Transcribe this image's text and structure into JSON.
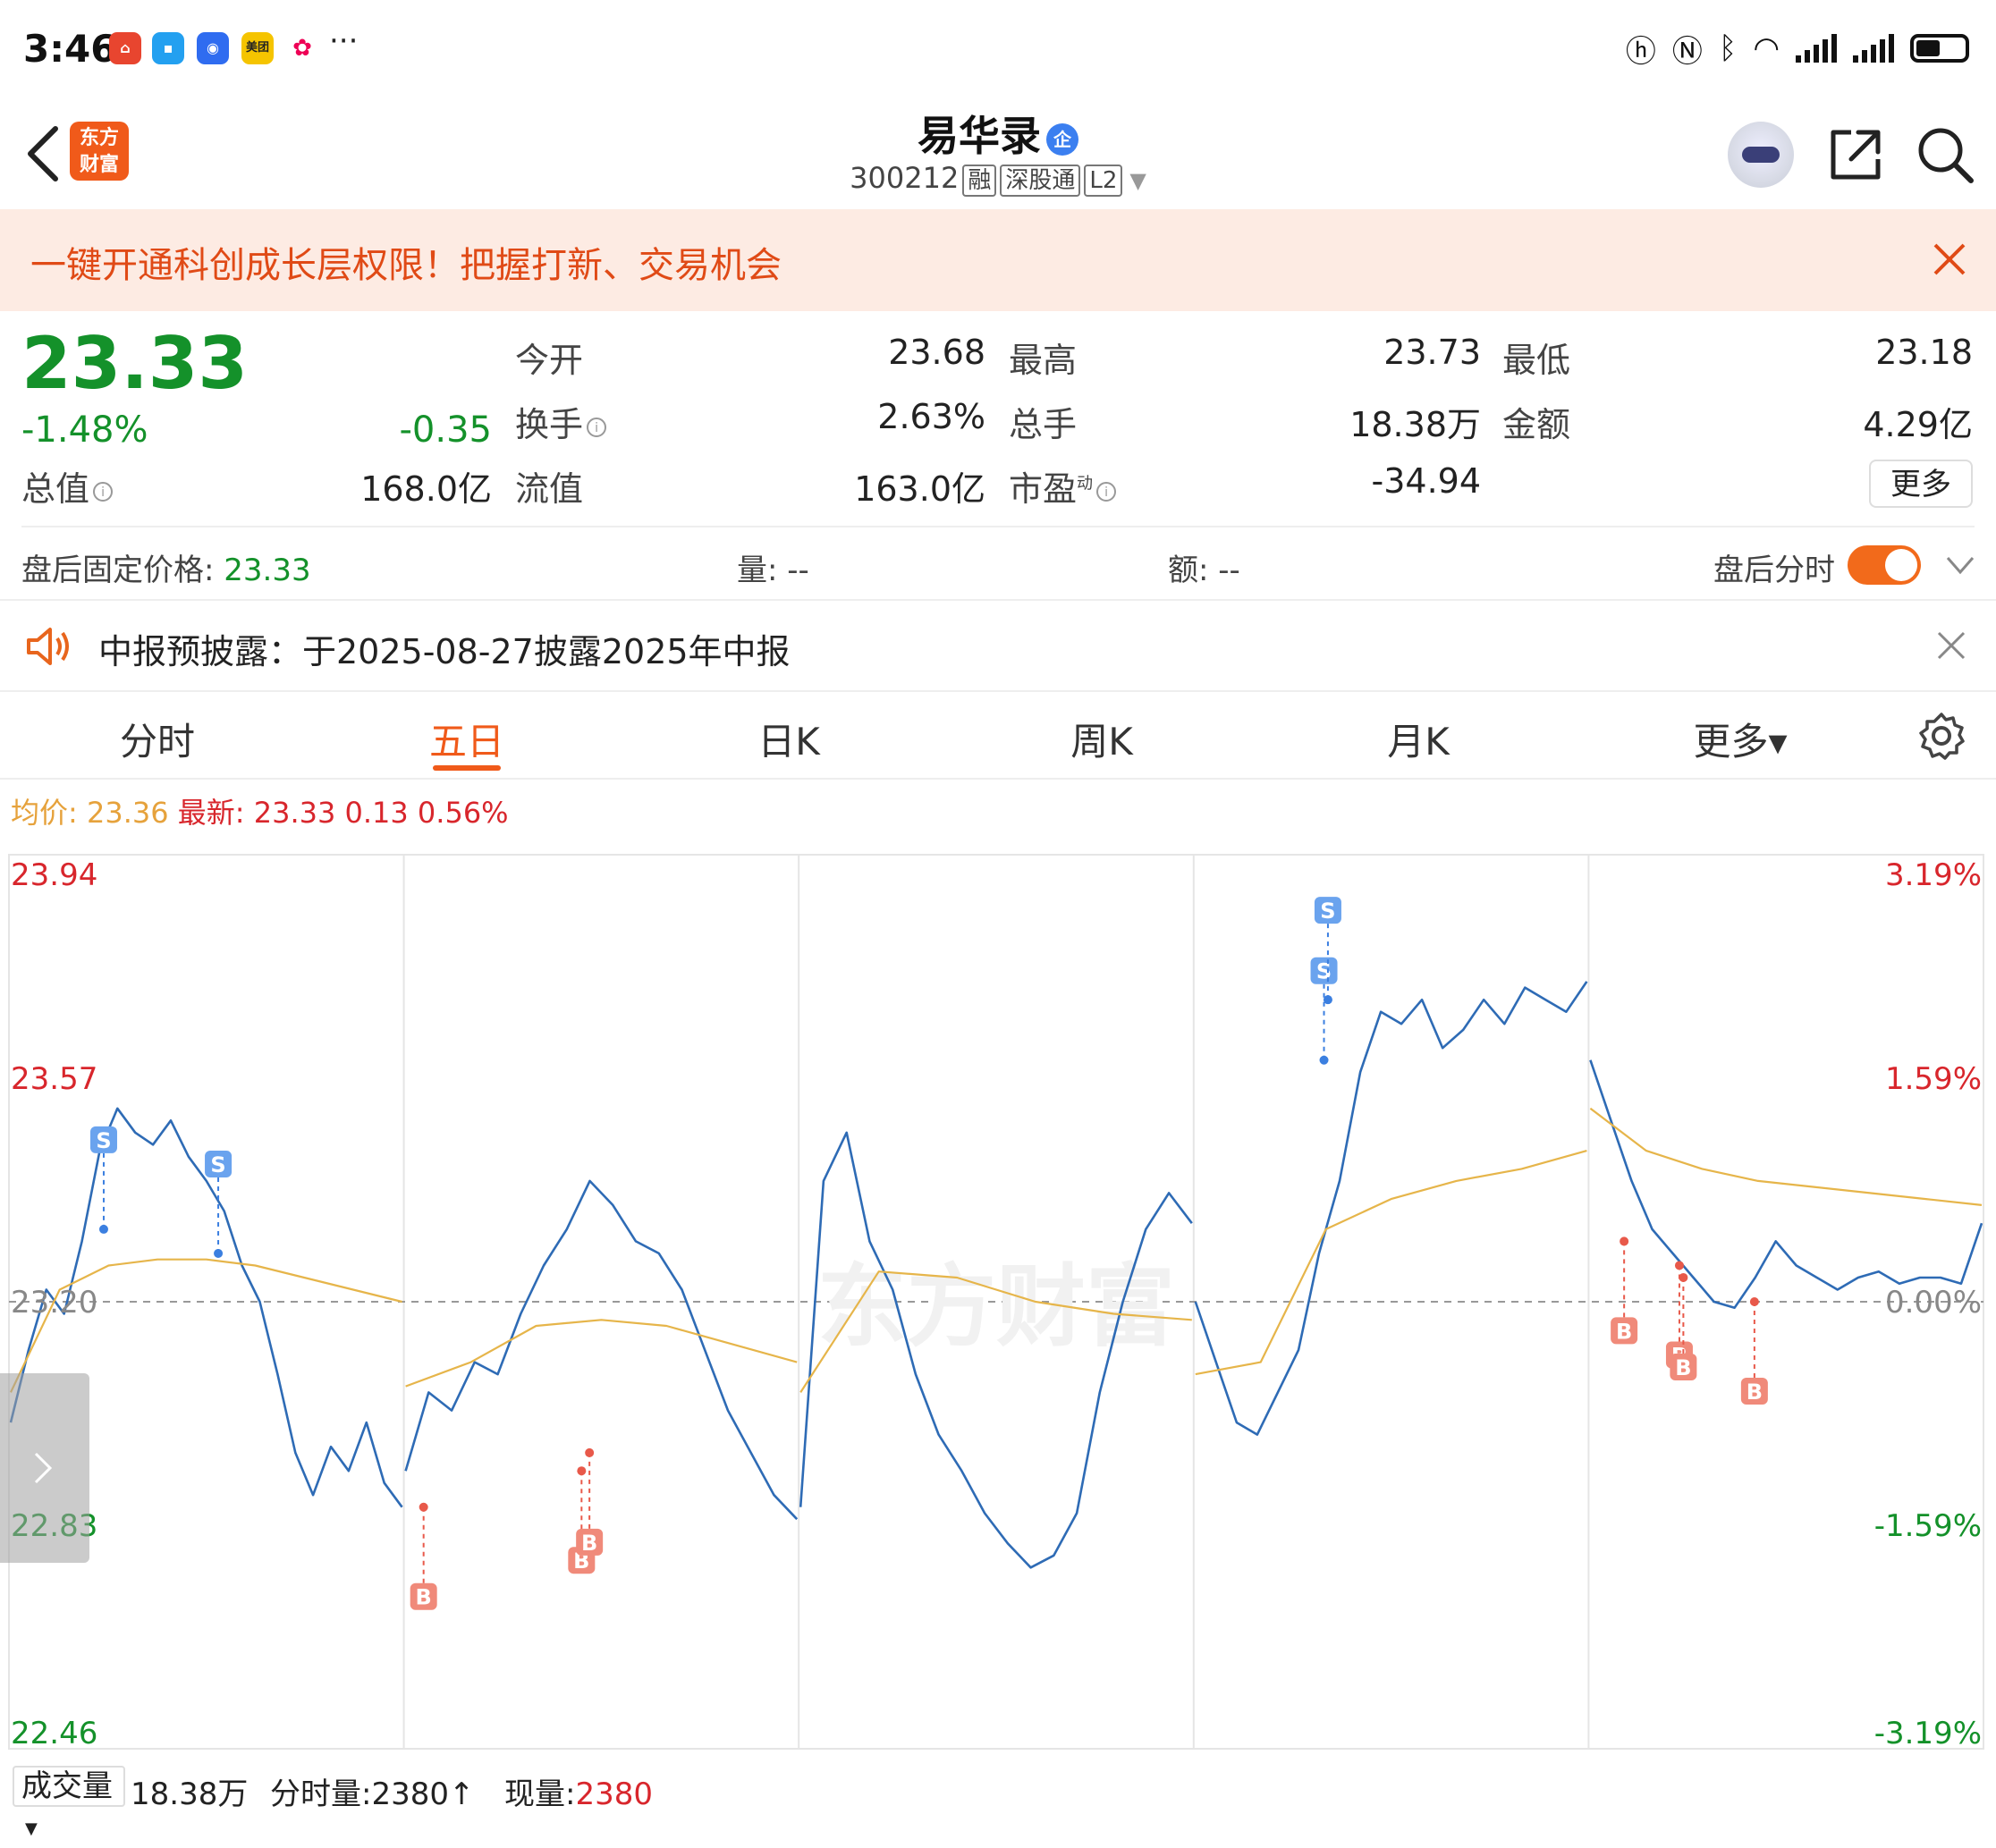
{
  "status_bar": {
    "time": "3:46",
    "app_icons": [
      {
        "name": "red-app-icon",
        "label": "",
        "color": "#e8452f"
      },
      {
        "name": "chat-app-icon",
        "label": "",
        "color": "#23a0f0"
      },
      {
        "name": "blue-app-icon",
        "label": "",
        "color": "#2f6cf0"
      },
      {
        "name": "meituan-app-icon",
        "label": "美团",
        "color": "#f5c400"
      },
      {
        "name": "flower-app-icon",
        "label": "",
        "color": "#ffffff"
      }
    ],
    "more": "···"
  },
  "header": {
    "stock_name": "易华录",
    "badge": "企",
    "stock_code": "300212",
    "tags": [
      "融",
      "深股通",
      "L2"
    ],
    "logo_text_top": "东方",
    "logo_text_bottom": "财富"
  },
  "banner": {
    "text": "一键开通科创成长层权限！把握打新、交易机会"
  },
  "quote": {
    "price": "23.33",
    "change_pct": "-1.48%",
    "change_val": "-0.35",
    "rows": [
      [
        {
          "label": "今开",
          "value": "23.68",
          "color": "#222222"
        },
        {
          "label": "最高",
          "value": "23.73",
          "color": "#d8262c"
        },
        {
          "label": "最低",
          "value": "23.18",
          "color": "#14912a"
        }
      ],
      [
        {
          "label": "换手",
          "value": "2.63%",
          "color": "#222222",
          "info": true
        },
        {
          "label": "总手",
          "value": "18.38万",
          "color": "#222222"
        },
        {
          "label": "金额",
          "value": "4.29亿",
          "color": "#222222"
        }
      ]
    ],
    "total_value_label": "总值",
    "total_value": "168.0亿",
    "float_value_label": "流值",
    "float_value": "163.0亿",
    "pe_label": "市盈",
    "pe_sup": "动",
    "pe_value": "-34.94",
    "more_button": "更多"
  },
  "afterhours": {
    "fixed_price_label": "盘后固定价格:",
    "fixed_price": "23.33",
    "volume_label": "量: --",
    "amount_label": "额: --",
    "toggle_label": "盘后分时",
    "toggle_on": true
  },
  "notice": {
    "text": "中报预披露：于2025-08-27披露2025年中报"
  },
  "tabs": [
    {
      "label": "分时",
      "active": false
    },
    {
      "label": "五日",
      "active": true
    },
    {
      "label": "日K",
      "active": false
    },
    {
      "label": "周K",
      "active": false
    },
    {
      "label": "月K",
      "active": false
    },
    {
      "label": "更多▾",
      "active": false
    }
  ],
  "legend": {
    "avg_label": "均价:",
    "avg_value": "23.36",
    "latest_label": "最新:",
    "latest_value": "23.33",
    "latest_change": "0.13",
    "latest_pct": "0.56%"
  },
  "chart_data": {
    "type": "line",
    "title": "",
    "days": 5,
    "ylim": [
      22.46,
      23.94
    ],
    "reference_price": 23.2,
    "y_ticks_left": [
      {
        "value": 23.94,
        "label": "23.94",
        "color": "#d8262c"
      },
      {
        "value": 23.57,
        "label": "23.57",
        "color": "#d8262c"
      },
      {
        "value": 23.2,
        "label": "23.20",
        "color": "#888888"
      },
      {
        "value": 22.83,
        "label": "22.83",
        "color": "#14912a"
      },
      {
        "value": 22.46,
        "label": "22.46",
        "color": "#14912a"
      }
    ],
    "y_ticks_right": [
      {
        "value": 23.94,
        "label": "3.19%",
        "color": "#d8262c"
      },
      {
        "value": 23.57,
        "label": "1.59%",
        "color": "#d8262c"
      },
      {
        "value": 23.2,
        "label": "0.00%",
        "color": "#888888"
      },
      {
        "value": 22.83,
        "label": "-1.59%",
        "color": "#14912a"
      },
      {
        "value": 22.46,
        "label": "-3.19%",
        "color": "#14912a"
      }
    ],
    "series": [
      {
        "color": "#2e6bb5",
        "days": [
          [
            23.0,
            23.12,
            23.22,
            23.18,
            23.3,
            23.45,
            23.52,
            23.48,
            23.46,
            23.5,
            23.44,
            23.4,
            23.35,
            23.26,
            23.2,
            23.08,
            22.95,
            22.88,
            22.96,
            22.92,
            23.0,
            22.9,
            22.86
          ],
          [
            22.92,
            23.05,
            23.02,
            23.1,
            23.08,
            23.18,
            23.26,
            23.32,
            23.4,
            23.36,
            23.3,
            23.28,
            23.22,
            23.12,
            23.02,
            22.95,
            22.88,
            22.84
          ],
          [
            22.86,
            23.4,
            23.48,
            23.3,
            23.22,
            23.08,
            22.98,
            22.92,
            22.85,
            22.8,
            22.76,
            22.78,
            22.85,
            23.05,
            23.2,
            23.32,
            23.38,
            23.33
          ],
          [
            23.2,
            23.1,
            23.0,
            22.98,
            23.05,
            23.12,
            23.28,
            23.4,
            23.58,
            23.68,
            23.66,
            23.7,
            23.62,
            23.65,
            23.7,
            23.66,
            23.72,
            23.7,
            23.68,
            23.73
          ],
          [
            23.6,
            23.5,
            23.4,
            23.32,
            23.28,
            23.24,
            23.2,
            23.19,
            23.24,
            23.3,
            23.26,
            23.24,
            23.22,
            23.24,
            23.25,
            23.23,
            23.24,
            23.24,
            23.23,
            23.33
          ]
        ]
      },
      {
        "color": "#e6b54a",
        "days": [
          [
            23.05,
            23.22,
            23.26,
            23.27,
            23.27,
            23.26,
            23.24,
            23.22,
            23.2
          ],
          [
            23.06,
            23.1,
            23.16,
            23.17,
            23.16,
            23.13,
            23.1
          ],
          [
            23.05,
            23.25,
            23.24,
            23.2,
            23.18,
            23.17
          ],
          [
            23.08,
            23.1,
            23.32,
            23.37,
            23.4,
            23.42,
            23.45
          ],
          [
            23.52,
            23.45,
            23.42,
            23.4,
            23.39,
            23.38,
            23.37,
            23.36
          ]
        ]
      }
    ],
    "markers": [
      {
        "day": 0,
        "pos": 0.24,
        "type": "S",
        "price": 23.32
      },
      {
        "day": 0,
        "pos": 0.53,
        "type": "S",
        "price": 23.28
      },
      {
        "day": 1,
        "pos": 0.05,
        "type": "B",
        "price": 22.86
      },
      {
        "day": 1,
        "pos": 0.45,
        "type": "B",
        "price": 22.92
      },
      {
        "day": 1,
        "pos": 0.47,
        "type": "B",
        "price": 22.95
      },
      {
        "day": 3,
        "pos": 0.33,
        "type": "S",
        "price": 23.6
      },
      {
        "day": 3,
        "pos": 0.34,
        "type": "S",
        "price": 23.7
      },
      {
        "day": 4,
        "pos": 0.09,
        "type": "B",
        "price": 23.3
      },
      {
        "day": 4,
        "pos": 0.23,
        "type": "B",
        "price": 23.26
      },
      {
        "day": 4,
        "pos": 0.24,
        "type": "B",
        "price": 23.24
      },
      {
        "day": 4,
        "pos": 0.42,
        "type": "B",
        "price": 23.2
      }
    ],
    "watermark": "东方财富"
  },
  "volume_bar": {
    "selector_label": "成交量",
    "total": "18.38万",
    "interval_label": "分时量:",
    "interval_value": "2380",
    "arrow": "↑",
    "current_label": "现量:",
    "current_value": "2380"
  }
}
